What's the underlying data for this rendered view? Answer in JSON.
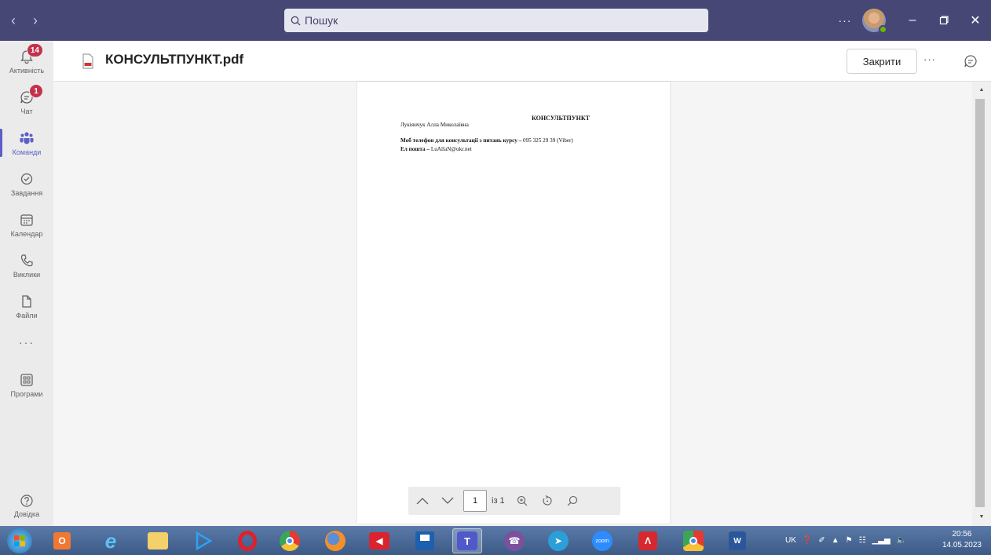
{
  "titlebar": {
    "search_placeholder": "Пошук",
    "more_label": "···"
  },
  "rail": {
    "items": [
      {
        "label": "Активність",
        "icon": "bell-icon",
        "badge": "14"
      },
      {
        "label": "Чат",
        "icon": "chat-icon",
        "badge": "1"
      },
      {
        "label": "Команди",
        "icon": "teams-icon",
        "badge": ""
      },
      {
        "label": "Завдання",
        "icon": "tasks-icon",
        "badge": ""
      },
      {
        "label": "Календар",
        "icon": "calendar-icon",
        "badge": ""
      },
      {
        "label": "Виклики",
        "icon": "phone-icon",
        "badge": ""
      },
      {
        "label": "Файли",
        "icon": "file-icon",
        "badge": ""
      },
      {
        "label": "Програми",
        "icon": "apps-icon",
        "badge": ""
      }
    ],
    "more": "···",
    "help": "Довідка"
  },
  "header": {
    "file_name": "КОНСУЛЬТПУНКТ.pdf",
    "close_label": "Закрити",
    "more_label": "···"
  },
  "document": {
    "title": "КОНСУЛЬТПУНКТ",
    "author": "Лукіянчук Алла Миколаївна",
    "phone_bold": "Моб телефон для консультації з питань курсу –",
    "phone_value": " 095 325 29 39 (Viber)",
    "email_bold": "Ел пошта –",
    "email_value": " LuAllaN@ukr.net"
  },
  "pdf_toolbar": {
    "page_current": "1",
    "page_of": "із 1"
  },
  "taskbar": {
    "lang": "UK",
    "time": "20:56",
    "date": "14.05.2023"
  },
  "colors": {
    "titlebar": "#464775",
    "accent": "#5b5fc7",
    "badge": "#c4314b"
  }
}
